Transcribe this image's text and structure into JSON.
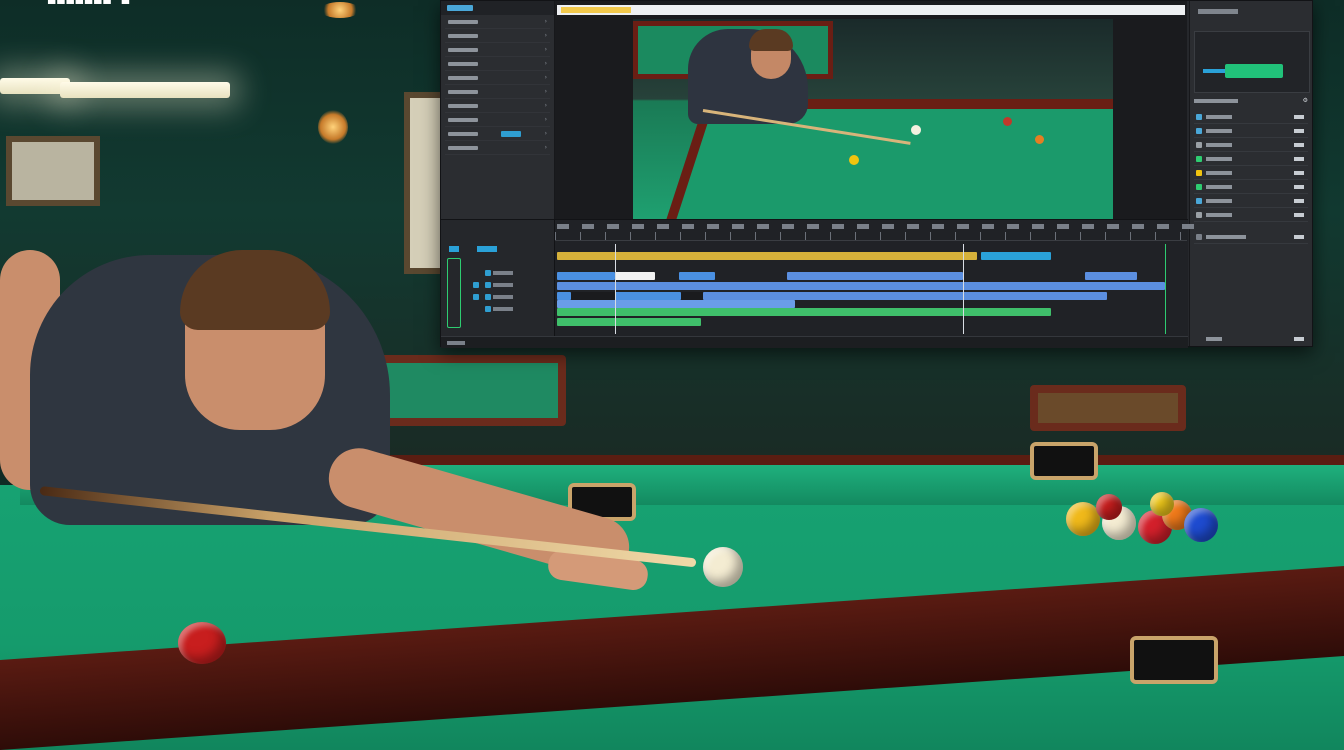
{
  "app": {
    "title": "",
    "theme": "dark video editor overlay on billiards photo"
  },
  "colors": {
    "accent_blue": "#4a90e2",
    "accent_green": "#2ecc71",
    "felt_green": "#17a272",
    "rail_wood": "#5a1b12",
    "export_button": "#21c27a"
  },
  "icons": [
    "menu-icon",
    "chevron-right-icon",
    "play-icon",
    "settings-icon",
    "close-icon"
  ],
  "editor": {
    "left_panel_rows": 9,
    "right_panel": {
      "export_label": "",
      "list_rows": 8
    },
    "timeline": {
      "tracks": [
        "video-1",
        "video-2",
        "overlay",
        "audio-1"
      ]
    }
  }
}
